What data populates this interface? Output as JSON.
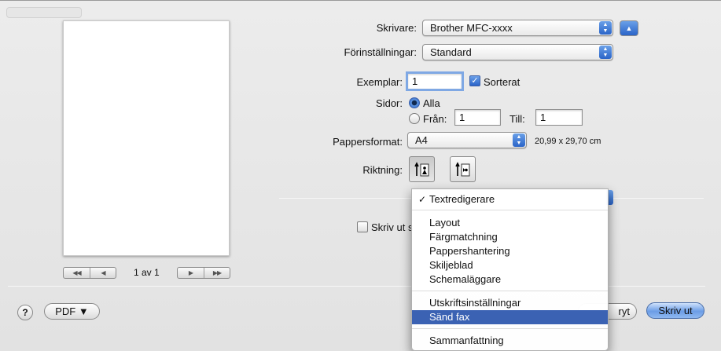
{
  "printer": {
    "label": "Skrivare:",
    "value": "Brother MFC-xxxx"
  },
  "presets": {
    "label": "Förinställningar:",
    "value": "Standard"
  },
  "copies": {
    "label": "Exemplar:",
    "value": "1",
    "collated_label": "Sorterat",
    "collated": true
  },
  "pages": {
    "label": "Sidor:",
    "all_label": "Alla",
    "from_label": "Från:",
    "from_value": "1",
    "to_label": "Till:",
    "to_value": "1",
    "selected": "all"
  },
  "paper_size": {
    "label": "Pappersformat:",
    "value": "A4",
    "dimensions": "20,99 x 29,70 cm"
  },
  "orientation": {
    "label": "Riktning:",
    "selected": "portrait"
  },
  "preview": {
    "page_count": "1 av 1",
    "first_icon": "◀◀",
    "prev_icon": "◀",
    "next_icon": "▶",
    "last_icon": "▶▶"
  },
  "partial_checkbox_label": "Skriv ut s",
  "panel_menu": {
    "selected_check": "✓",
    "items": [
      "Textredigerare",
      "Layout",
      "Färgmatchning",
      "Pappershantering",
      "Skiljeblad",
      "Schemaläggare",
      "Utskriftsinställningar",
      "Sänd fax",
      "Sammanfattning"
    ],
    "highlighted_item": "Sänd fax"
  },
  "footer": {
    "help_label": "?",
    "pdf_label": "PDF ▼",
    "cancel_partial": "ryt",
    "print_label": "Skriv ut"
  },
  "colors": {
    "accent": "#2a64c8",
    "menu_highlight": "#3b62b3"
  }
}
